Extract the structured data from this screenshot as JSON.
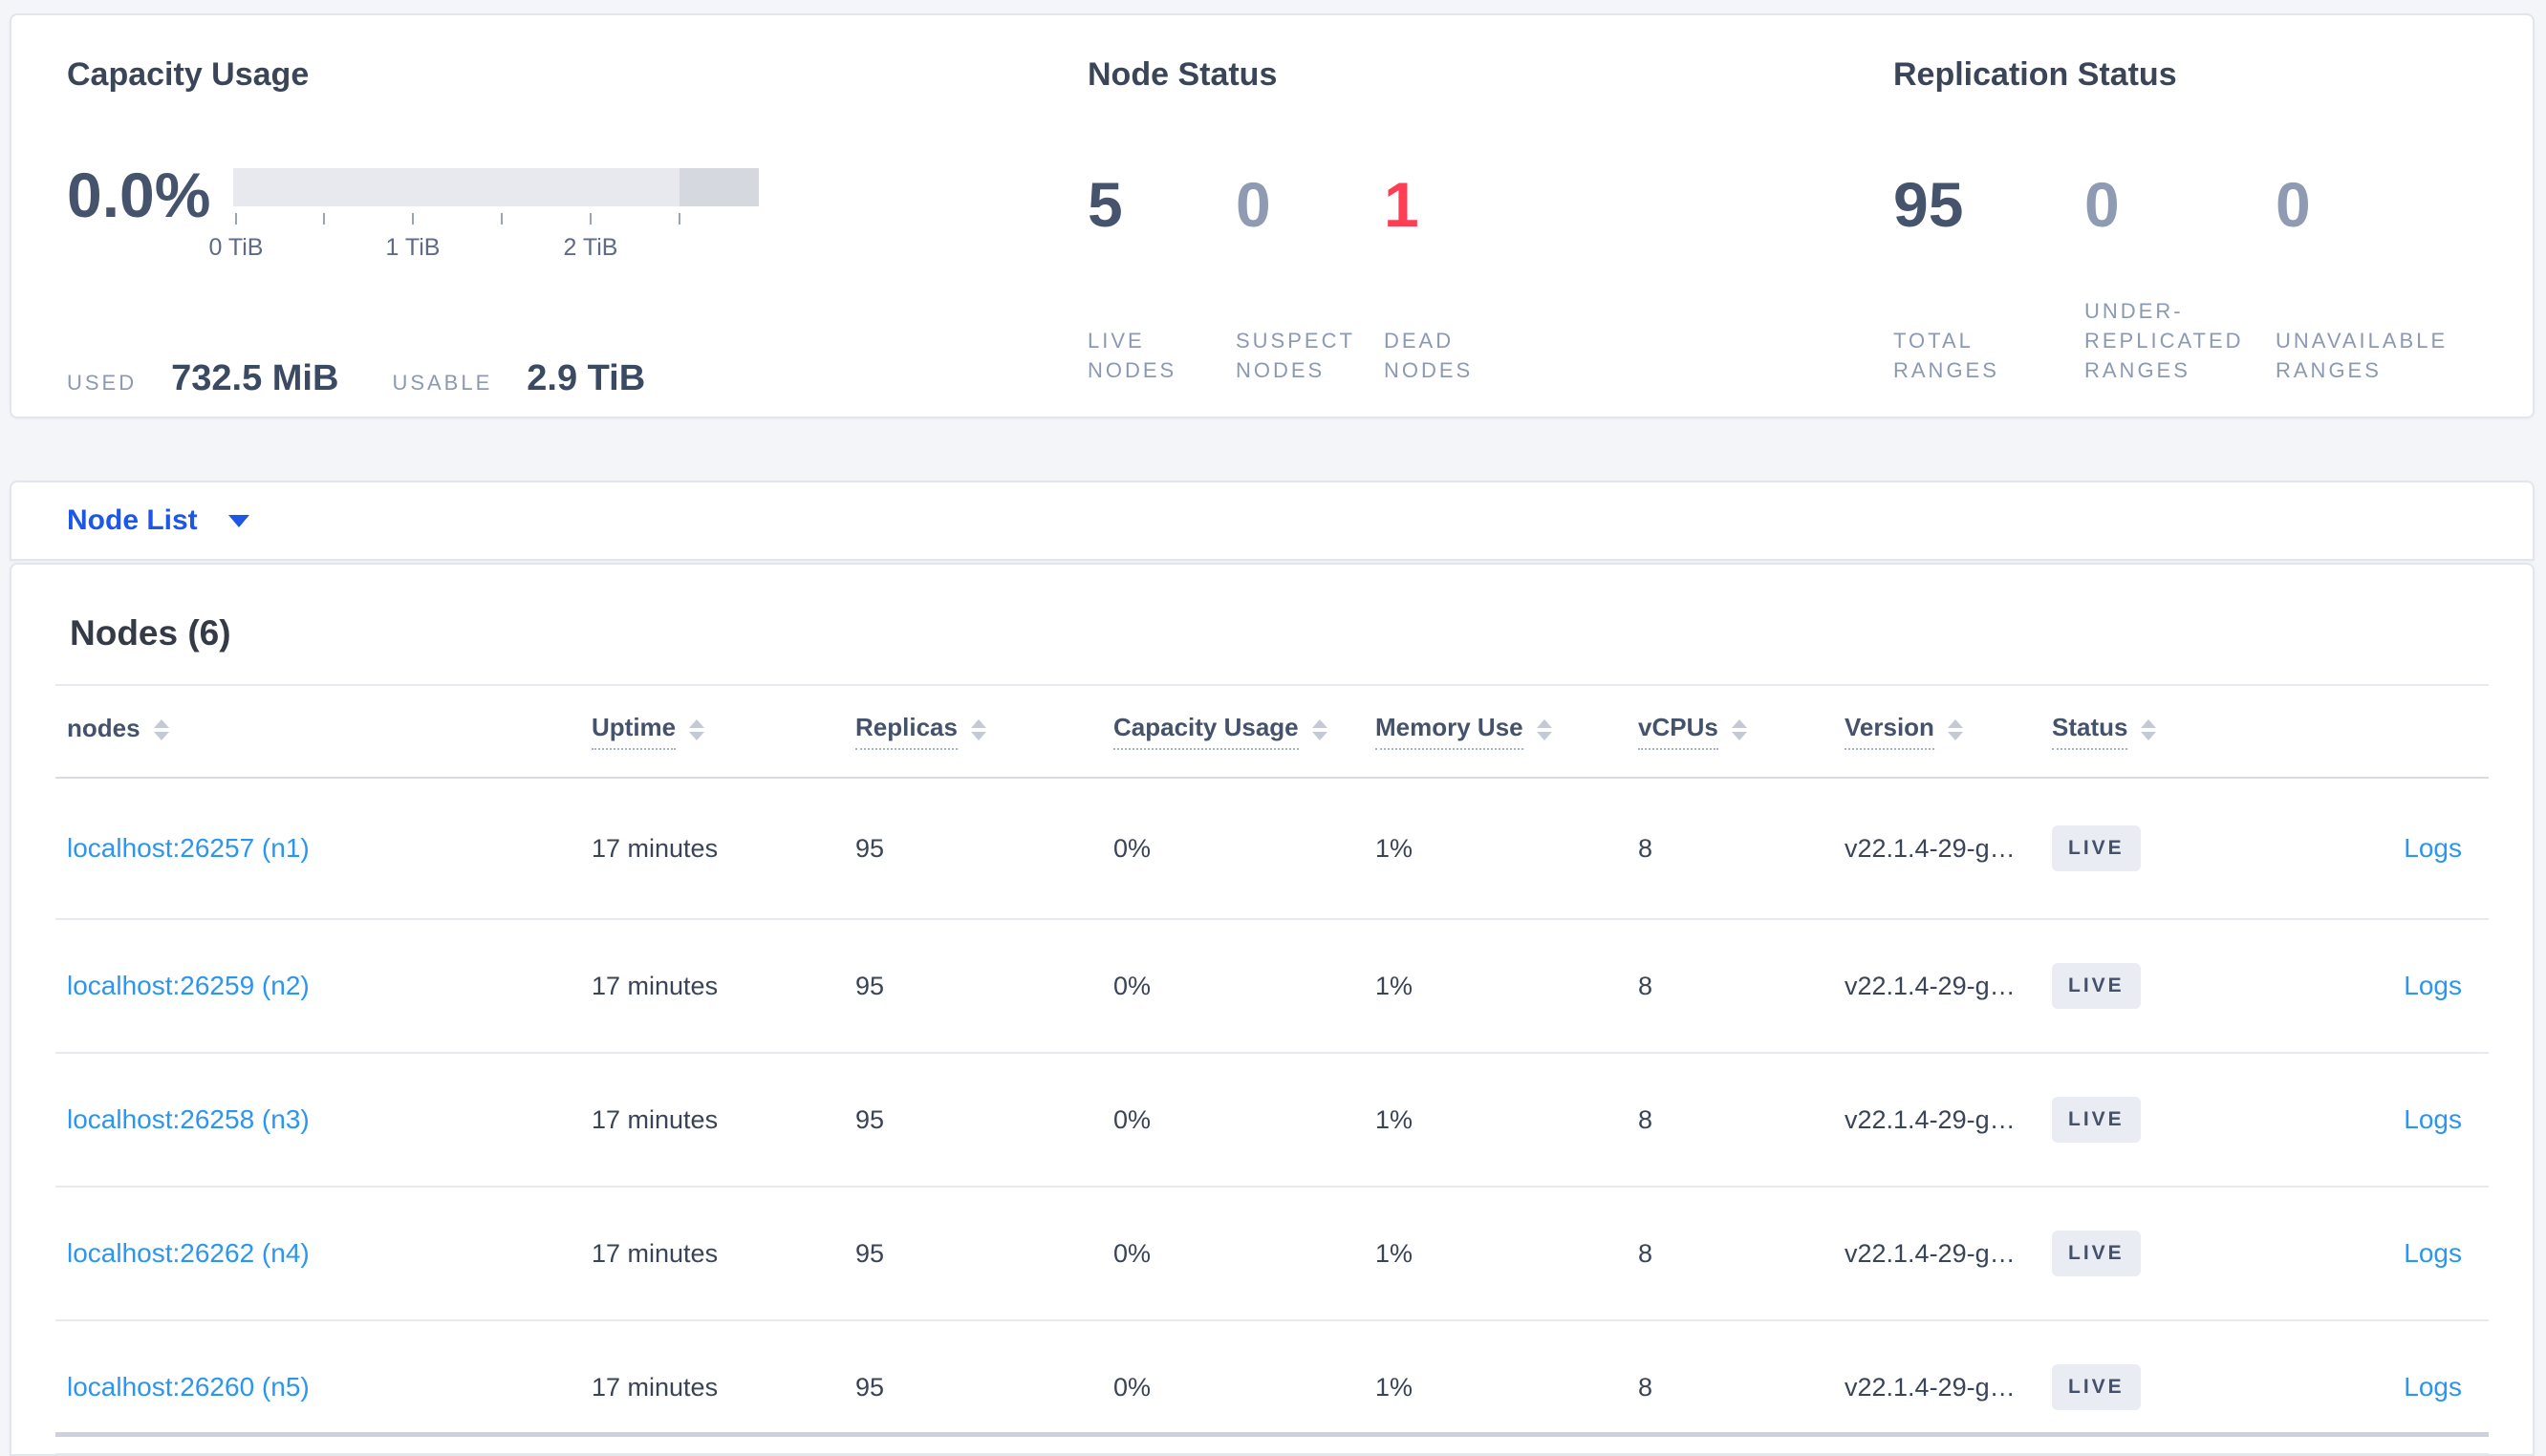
{
  "colors": {
    "page-bg": "#f4f5f9",
    "card-bg": "#ffffff",
    "card-border": "#e2e5eb",
    "title": "#3b4558",
    "num-dark": "#46536d",
    "num-muted": "#8e9bb3",
    "num-red": "#ff3d54",
    "label-muted": "#8c99b3",
    "bar-light": "#e7e9ef",
    "bar-dark": "#d5d8df",
    "tick": "#97a3b8",
    "tick-label": "#5f6b85",
    "stat-value": "#3b4a63",
    "nodelist-blue": "#1d57e8",
    "link-blue": "#2b96f2",
    "cell": "#394456",
    "header": "#45526b",
    "dotted": "#a9b3c6",
    "sort": "#c3cad6",
    "divider": "#e7e9ee",
    "divider-strong": "#ccd1dd",
    "badge-bg": "#e9edf3"
  },
  "capacity": {
    "title": "Capacity Usage",
    "percent": "0.0%",
    "tick_labels": [
      "0 TiB",
      "1 TiB",
      "2 TiB"
    ],
    "used_label": "USED",
    "used_value": "732.5 MiB",
    "usable_label": "USABLE",
    "usable_value": "2.9 TiB"
  },
  "node_status": {
    "title": "Node Status",
    "stats": [
      {
        "value": "5",
        "label": "LIVE NODES"
      },
      {
        "value": "0",
        "label": "SUSPECT NODES"
      },
      {
        "value": "1",
        "label": "DEAD NODES"
      }
    ]
  },
  "replication": {
    "title": "Replication Status",
    "stats": [
      {
        "value": "95",
        "label": "TOTAL RANGES"
      },
      {
        "value": "0",
        "label": "UNDER-REPLICATED RANGES"
      },
      {
        "value": "0",
        "label": "UNAVAILABLE RANGES"
      }
    ]
  },
  "view_selector": {
    "label": "Node List"
  },
  "table": {
    "title": "Nodes (6)",
    "columns": [
      {
        "label": "nodes"
      },
      {
        "label": "Uptime"
      },
      {
        "label": "Replicas"
      },
      {
        "label": "Capacity Usage"
      },
      {
        "label": "Memory Use"
      },
      {
        "label": "vCPUs"
      },
      {
        "label": "Version"
      },
      {
        "label": "Status"
      }
    ],
    "rows": [
      {
        "node": "localhost:26257 (n1)",
        "uptime": "17 minutes",
        "replicas": "95",
        "capacity": "0%",
        "memory": "1%",
        "vcpus": "8",
        "version": "v22.1.4-29-g…",
        "status": "LIVE",
        "logs": "Logs"
      },
      {
        "node": "localhost:26259 (n2)",
        "uptime": "17 minutes",
        "replicas": "95",
        "capacity": "0%",
        "memory": "1%",
        "vcpus": "8",
        "version": "v22.1.4-29-g…",
        "status": "LIVE",
        "logs": "Logs"
      },
      {
        "node": "localhost:26258 (n3)",
        "uptime": "17 minutes",
        "replicas": "95",
        "capacity": "0%",
        "memory": "1%",
        "vcpus": "8",
        "version": "v22.1.4-29-g…",
        "status": "LIVE",
        "logs": "Logs"
      },
      {
        "node": "localhost:26262 (n4)",
        "uptime": "17 minutes",
        "replicas": "95",
        "capacity": "0%",
        "memory": "1%",
        "vcpus": "8",
        "version": "v22.1.4-29-g…",
        "status": "LIVE",
        "logs": "Logs"
      },
      {
        "node": "localhost:26260 (n5)",
        "uptime": "17 minutes",
        "replicas": "95",
        "capacity": "0%",
        "memory": "1%",
        "vcpus": "8",
        "version": "v22.1.4-29-g…",
        "status": "LIVE",
        "logs": "Logs"
      }
    ]
  }
}
